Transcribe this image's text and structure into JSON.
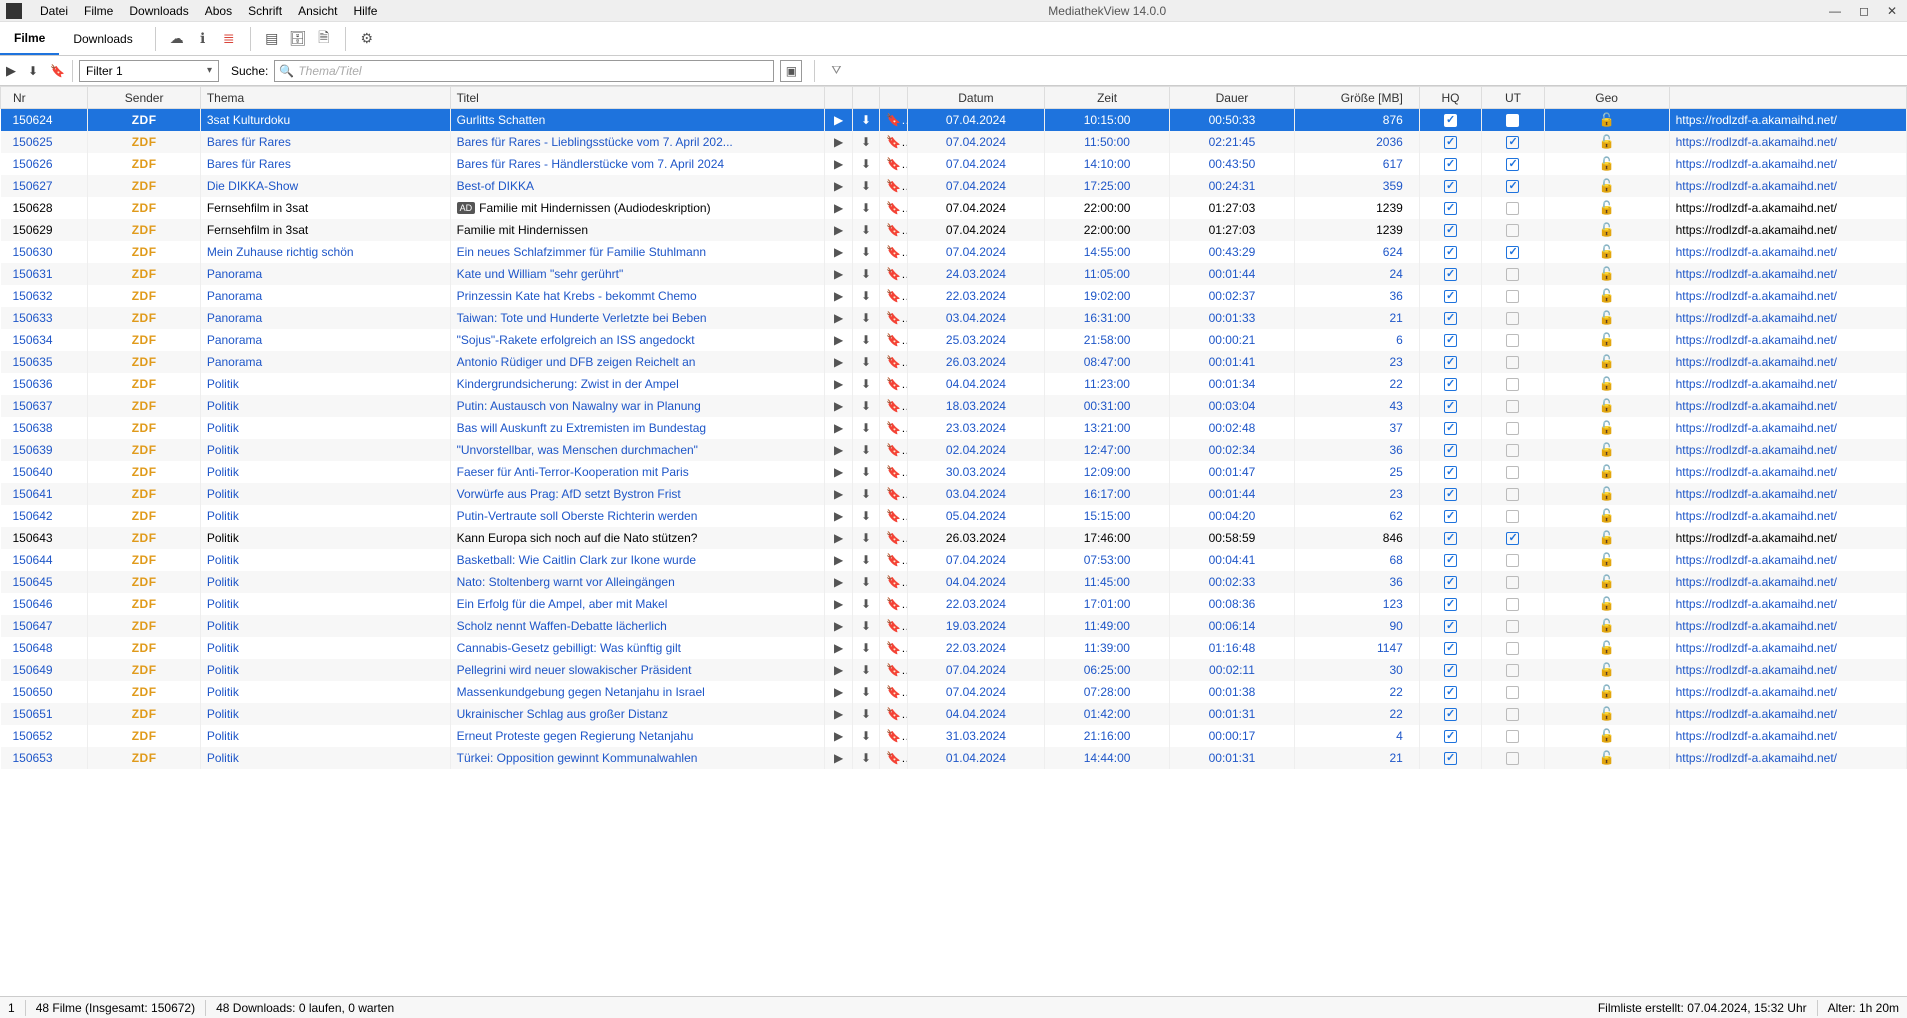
{
  "window": {
    "title": "MediathekView 14.0.0"
  },
  "menu": {
    "items": [
      "Datei",
      "Filme",
      "Downloads",
      "Abos",
      "Schrift",
      "Ansicht",
      "Hilfe"
    ]
  },
  "tabs": {
    "filme": "Filme",
    "downloads": "Downloads"
  },
  "filter": {
    "label": "Filter 1"
  },
  "search": {
    "label": "Suche:",
    "placeholder": "Thema/Titel"
  },
  "headers": {
    "nr": "Nr",
    "sender": "Sender",
    "thema": "Thema",
    "titel": "Titel",
    "datum": "Datum",
    "zeit": "Zeit",
    "dauer": "Dauer",
    "size": "Größe [MB]",
    "hq": "HQ",
    "ut": "UT",
    "geo": "Geo"
  },
  "rows": [
    {
      "nr": "150624",
      "sender": "ZDF",
      "thema": "3sat Kulturdoku",
      "titel": "Gurlitts Schatten",
      "datum": "07.04.2024",
      "zeit": "10:15:00",
      "dauer": "00:50:33",
      "size": "876",
      "hq": true,
      "ut": false,
      "url": "https://rodlzdf-a.akamaihd.net/",
      "style": "sel",
      "selected": true
    },
    {
      "nr": "150625",
      "sender": "ZDF",
      "thema": "Bares für Rares",
      "titel": "Bares für Rares - Lieblingsstücke vom 7. April 202...",
      "datum": "07.04.2024",
      "zeit": "11:50:00",
      "dauer": "02:21:45",
      "size": "2036",
      "hq": true,
      "ut": true,
      "url": "https://rodlzdf-a.akamaihd.net/",
      "style": "link"
    },
    {
      "nr": "150626",
      "sender": "ZDF",
      "thema": "Bares für Rares",
      "titel": "Bares für Rares - Händlerstücke vom 7. April 2024",
      "datum": "07.04.2024",
      "zeit": "14:10:00",
      "dauer": "00:43:50",
      "size": "617",
      "hq": true,
      "ut": true,
      "url": "https://rodlzdf-a.akamaihd.net/",
      "style": "link"
    },
    {
      "nr": "150627",
      "sender": "ZDF",
      "thema": "Die DIKKA-Show",
      "titel": "Best-of DIKKA",
      "datum": "07.04.2024",
      "zeit": "17:25:00",
      "dauer": "00:24:31",
      "size": "359",
      "hq": true,
      "ut": true,
      "url": "https://rodlzdf-a.akamaihd.net/",
      "style": "link"
    },
    {
      "nr": "150628",
      "sender": "ZDF",
      "thema": "Fernsehfilm in 3sat",
      "titel": "Familie mit Hindernissen (Audiodeskription)",
      "datum": "07.04.2024",
      "zeit": "22:00:00",
      "dauer": "01:27:03",
      "size": "1239",
      "hq": true,
      "ut": false,
      "url": "https://rodlzdf-a.akamaihd.net/",
      "style": "black",
      "ad": true
    },
    {
      "nr": "150629",
      "sender": "ZDF",
      "thema": "Fernsehfilm in 3sat",
      "titel": "Familie mit Hindernissen",
      "datum": "07.04.2024",
      "zeit": "22:00:00",
      "dauer": "01:27:03",
      "size": "1239",
      "hq": true,
      "ut": false,
      "url": "https://rodlzdf-a.akamaihd.net/",
      "style": "black"
    },
    {
      "nr": "150630",
      "sender": "ZDF",
      "thema": "Mein Zuhause richtig schön",
      "titel": "Ein neues Schlafzimmer für Familie Stuhlmann",
      "datum": "07.04.2024",
      "zeit": "14:55:00",
      "dauer": "00:43:29",
      "size": "624",
      "hq": true,
      "ut": true,
      "url": "https://rodlzdf-a.akamaihd.net/",
      "style": "link"
    },
    {
      "nr": "150631",
      "sender": "ZDF",
      "thema": "Panorama",
      "titel": "Kate und William \"sehr gerührt\"",
      "datum": "24.03.2024",
      "zeit": "11:05:00",
      "dauer": "00:01:44",
      "size": "24",
      "hq": true,
      "ut": false,
      "url": "https://rodlzdf-a.akamaihd.net/",
      "style": "link"
    },
    {
      "nr": "150632",
      "sender": "ZDF",
      "thema": "Panorama",
      "titel": "Prinzessin Kate hat Krebs - bekommt Chemo",
      "datum": "22.03.2024",
      "zeit": "19:02:00",
      "dauer": "00:02:37",
      "size": "36",
      "hq": true,
      "ut": false,
      "url": "https://rodlzdf-a.akamaihd.net/",
      "style": "link"
    },
    {
      "nr": "150633",
      "sender": "ZDF",
      "thema": "Panorama",
      "titel": "Taiwan: Tote und Hunderte Verletzte bei Beben",
      "datum": "03.04.2024",
      "zeit": "16:31:00",
      "dauer": "00:01:33",
      "size": "21",
      "hq": true,
      "ut": false,
      "url": "https://rodlzdf-a.akamaihd.net/",
      "style": "link"
    },
    {
      "nr": "150634",
      "sender": "ZDF",
      "thema": "Panorama",
      "titel": "\"Sojus\"-Rakete erfolgreich an ISS angedockt",
      "datum": "25.03.2024",
      "zeit": "21:58:00",
      "dauer": "00:00:21",
      "size": "6",
      "hq": true,
      "ut": false,
      "url": "https://rodlzdf-a.akamaihd.net/",
      "style": "link"
    },
    {
      "nr": "150635",
      "sender": "ZDF",
      "thema": "Panorama",
      "titel": "Antonio Rüdiger und DFB zeigen Reichelt an",
      "datum": "26.03.2024",
      "zeit": "08:47:00",
      "dauer": "00:01:41",
      "size": "23",
      "hq": true,
      "ut": false,
      "url": "https://rodlzdf-a.akamaihd.net/",
      "style": "link"
    },
    {
      "nr": "150636",
      "sender": "ZDF",
      "thema": "Politik",
      "titel": "Kindergrundsicherung: Zwist in der Ampel",
      "datum": "04.04.2024",
      "zeit": "11:23:00",
      "dauer": "00:01:34",
      "size": "22",
      "hq": true,
      "ut": false,
      "url": "https://rodlzdf-a.akamaihd.net/",
      "style": "link"
    },
    {
      "nr": "150637",
      "sender": "ZDF",
      "thema": "Politik",
      "titel": "Putin: Austausch von Nawalny war in Planung",
      "datum": "18.03.2024",
      "zeit": "00:31:00",
      "dauer": "00:03:04",
      "size": "43",
      "hq": true,
      "ut": false,
      "url": "https://rodlzdf-a.akamaihd.net/",
      "style": "link"
    },
    {
      "nr": "150638",
      "sender": "ZDF",
      "thema": "Politik",
      "titel": "Bas will Auskunft zu Extremisten im Bundestag",
      "datum": "23.03.2024",
      "zeit": "13:21:00",
      "dauer": "00:02:48",
      "size": "37",
      "hq": true,
      "ut": false,
      "url": "https://rodlzdf-a.akamaihd.net/",
      "style": "link"
    },
    {
      "nr": "150639",
      "sender": "ZDF",
      "thema": "Politik",
      "titel": "\"Unvorstellbar, was Menschen durchmachen\"",
      "datum": "02.04.2024",
      "zeit": "12:47:00",
      "dauer": "00:02:34",
      "size": "36",
      "hq": true,
      "ut": false,
      "url": "https://rodlzdf-a.akamaihd.net/",
      "style": "link"
    },
    {
      "nr": "150640",
      "sender": "ZDF",
      "thema": "Politik",
      "titel": "Faeser für Anti-Terror-Kooperation mit Paris",
      "datum": "30.03.2024",
      "zeit": "12:09:00",
      "dauer": "00:01:47",
      "size": "25",
      "hq": true,
      "ut": false,
      "url": "https://rodlzdf-a.akamaihd.net/",
      "style": "link"
    },
    {
      "nr": "150641",
      "sender": "ZDF",
      "thema": "Politik",
      "titel": "Vorwürfe aus Prag: AfD setzt Bystron Frist",
      "datum": "03.04.2024",
      "zeit": "16:17:00",
      "dauer": "00:01:44",
      "size": "23",
      "hq": true,
      "ut": false,
      "url": "https://rodlzdf-a.akamaihd.net/",
      "style": "link"
    },
    {
      "nr": "150642",
      "sender": "ZDF",
      "thema": "Politik",
      "titel": "Putin-Vertraute soll Oberste Richterin werden",
      "datum": "05.04.2024",
      "zeit": "15:15:00",
      "dauer": "00:04:20",
      "size": "62",
      "hq": true,
      "ut": false,
      "url": "https://rodlzdf-a.akamaihd.net/",
      "style": "link"
    },
    {
      "nr": "150643",
      "sender": "ZDF",
      "thema": "Politik",
      "titel": "Kann Europa sich noch auf die Nato stützen?",
      "datum": "26.03.2024",
      "zeit": "17:46:00",
      "dauer": "00:58:59",
      "size": "846",
      "hq": true,
      "ut": true,
      "url": "https://rodlzdf-a.akamaihd.net/",
      "style": "black"
    },
    {
      "nr": "150644",
      "sender": "ZDF",
      "thema": "Politik",
      "titel": "Basketball: Wie Caitlin Clark zur Ikone wurde",
      "datum": "07.04.2024",
      "zeit": "07:53:00",
      "dauer": "00:04:41",
      "size": "68",
      "hq": true,
      "ut": false,
      "url": "https://rodlzdf-a.akamaihd.net/",
      "style": "link"
    },
    {
      "nr": "150645",
      "sender": "ZDF",
      "thema": "Politik",
      "titel": "Nato: Stoltenberg warnt vor Alleingängen",
      "datum": "04.04.2024",
      "zeit": "11:45:00",
      "dauer": "00:02:33",
      "size": "36",
      "hq": true,
      "ut": false,
      "url": "https://rodlzdf-a.akamaihd.net/",
      "style": "link"
    },
    {
      "nr": "150646",
      "sender": "ZDF",
      "thema": "Politik",
      "titel": "Ein Erfolg für die Ampel, aber mit Makel",
      "datum": "22.03.2024",
      "zeit": "17:01:00",
      "dauer": "00:08:36",
      "size": "123",
      "hq": true,
      "ut": false,
      "url": "https://rodlzdf-a.akamaihd.net/",
      "style": "link"
    },
    {
      "nr": "150647",
      "sender": "ZDF",
      "thema": "Politik",
      "titel": "Scholz nennt Waffen-Debatte lächerlich",
      "datum": "19.03.2024",
      "zeit": "11:49:00",
      "dauer": "00:06:14",
      "size": "90",
      "hq": true,
      "ut": false,
      "url": "https://rodlzdf-a.akamaihd.net/",
      "style": "link"
    },
    {
      "nr": "150648",
      "sender": "ZDF",
      "thema": "Politik",
      "titel": "Cannabis-Gesetz gebilligt: Was künftig gilt",
      "datum": "22.03.2024",
      "zeit": "11:39:00",
      "dauer": "01:16:48",
      "size": "1147",
      "hq": true,
      "ut": false,
      "url": "https://rodlzdf-a.akamaihd.net/",
      "style": "link"
    },
    {
      "nr": "150649",
      "sender": "ZDF",
      "thema": "Politik",
      "titel": "Pellegrini wird neuer slowakischer Präsident",
      "datum": "07.04.2024",
      "zeit": "06:25:00",
      "dauer": "00:02:11",
      "size": "30",
      "hq": true,
      "ut": false,
      "url": "https://rodlzdf-a.akamaihd.net/",
      "style": "link"
    },
    {
      "nr": "150650",
      "sender": "ZDF",
      "thema": "Politik",
      "titel": "Massenkundgebung gegen Netanjahu in Israel",
      "datum": "07.04.2024",
      "zeit": "07:28:00",
      "dauer": "00:01:38",
      "size": "22",
      "hq": true,
      "ut": false,
      "url": "https://rodlzdf-a.akamaihd.net/",
      "style": "link"
    },
    {
      "nr": "150651",
      "sender": "ZDF",
      "thema": "Politik",
      "titel": "Ukrainischer Schlag aus großer Distanz",
      "datum": "04.04.2024",
      "zeit": "01:42:00",
      "dauer": "00:01:31",
      "size": "22",
      "hq": true,
      "ut": false,
      "url": "https://rodlzdf-a.akamaihd.net/",
      "style": "link"
    },
    {
      "nr": "150652",
      "sender": "ZDF",
      "thema": "Politik",
      "titel": "Erneut Proteste gegen Regierung Netanjahu",
      "datum": "31.03.2024",
      "zeit": "21:16:00",
      "dauer": "00:00:17",
      "size": "4",
      "hq": true,
      "ut": false,
      "url": "https://rodlzdf-a.akamaihd.net/",
      "style": "link"
    },
    {
      "nr": "150653",
      "sender": "ZDF",
      "thema": "Politik",
      "titel": "Türkei: Opposition gewinnt Kommunalwahlen",
      "datum": "01.04.2024",
      "zeit": "14:44:00",
      "dauer": "00:01:31",
      "size": "21",
      "hq": true,
      "ut": false,
      "url": "https://rodlzdf-a.akamaihd.net/",
      "style": "link"
    }
  ],
  "status": {
    "idx": "1",
    "filme": "48 Filme (Insgesamt: 150672)",
    "downloads": "48 Downloads: 0 laufen, 0 warten",
    "filmliste": "Filmliste erstellt: 07.04.2024, 15:32 Uhr",
    "alter": "Alter: 1h 20m"
  }
}
